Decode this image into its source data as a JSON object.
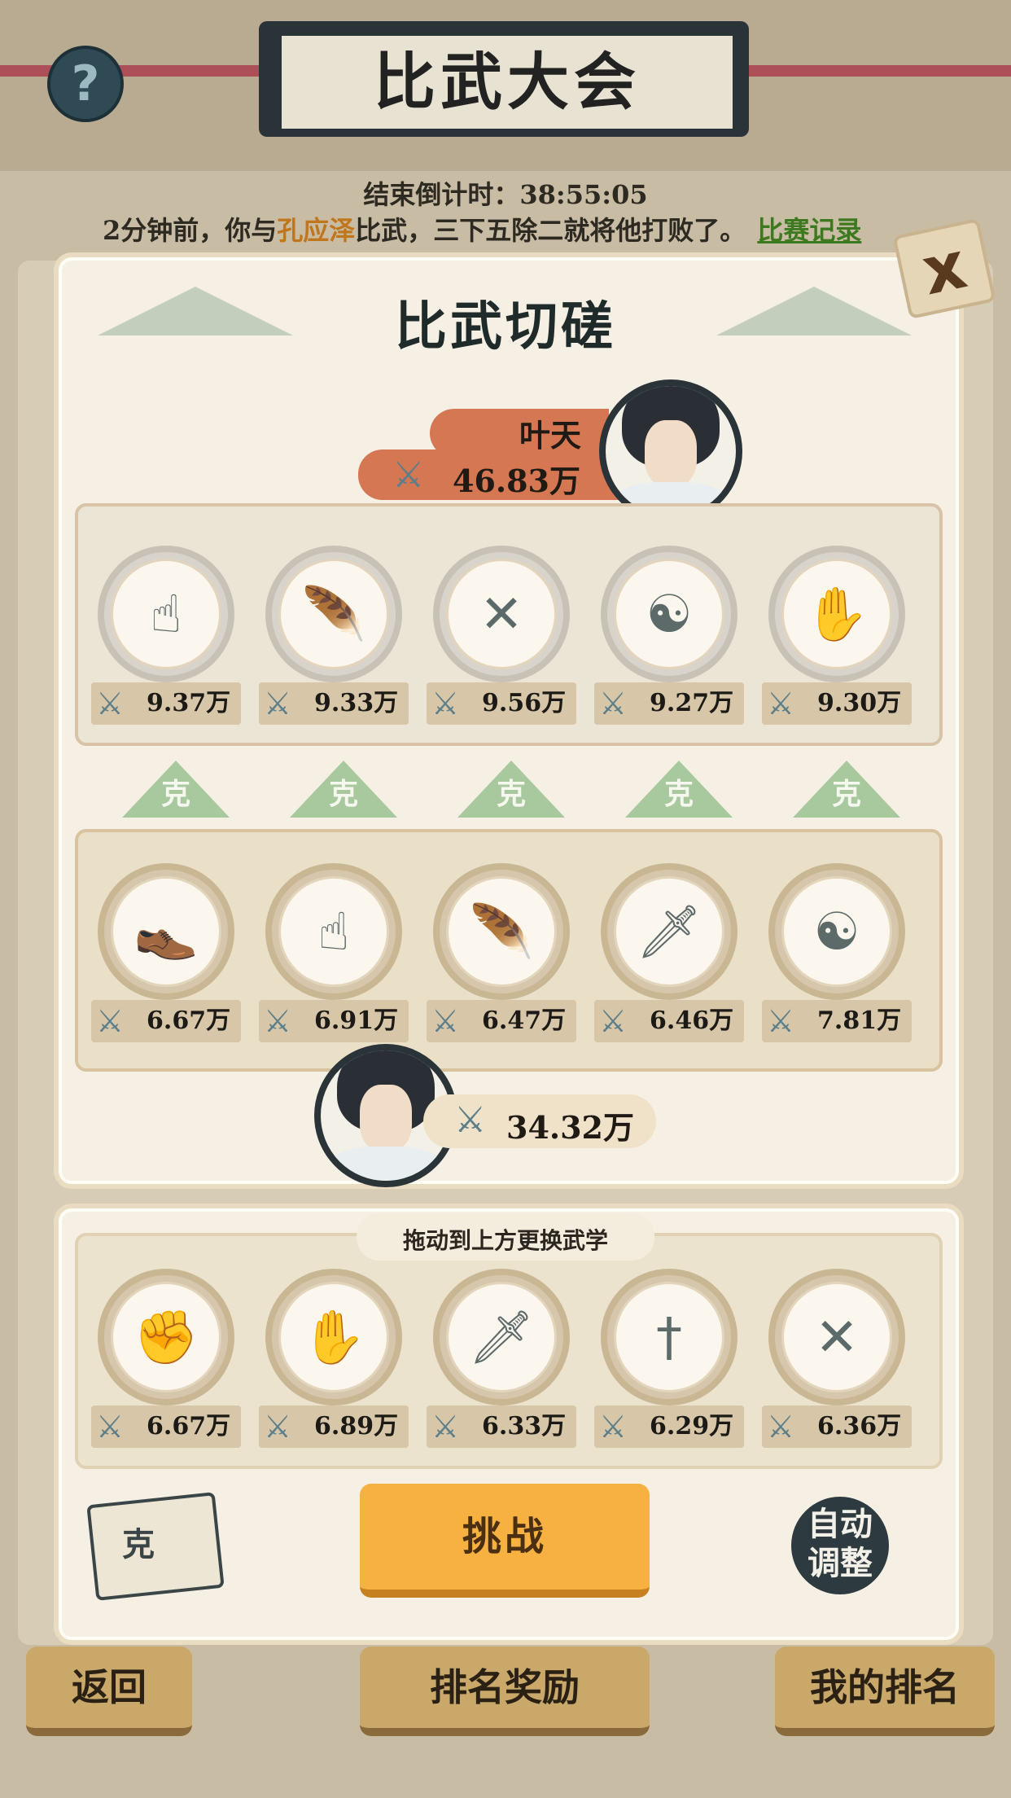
{
  "header": {
    "title": "比武大会",
    "help_icon": "?",
    "countdown": "结束倒计时：38:55:05",
    "log_prefix": "2分钟前，你与",
    "log_name": "孔应泽",
    "log_suffix": "比武，三下五除二就将他打败了。",
    "log_link": "比赛记录"
  },
  "dialog": {
    "title": "比武切磋",
    "close_icon": "x"
  },
  "opponent": {
    "name": "叶天",
    "power": "46.83万",
    "skills": [
      {
        "icon": "finger-gesture-icon",
        "glyph": "☝",
        "power": "9.37万"
      },
      {
        "icon": "feather-icon",
        "glyph": "🪶",
        "power": "9.33万"
      },
      {
        "icon": "crossed-spears-icon",
        "glyph": "✕",
        "power": "9.56万"
      },
      {
        "icon": "meditation-icon",
        "glyph": "☯",
        "power": "9.27万"
      },
      {
        "icon": "open-palm-icon",
        "glyph": "✋",
        "power": "9.30万"
      }
    ]
  },
  "counter_label": "克",
  "player": {
    "power": "34.32万",
    "skills": [
      {
        "icon": "boot-icon",
        "glyph": "👞",
        "power": "6.67万"
      },
      {
        "icon": "finger-gesture-icon",
        "glyph": "☝",
        "power": "6.91万"
      },
      {
        "icon": "feather-icon",
        "glyph": "🪶",
        "power": "6.47万"
      },
      {
        "icon": "throwing-daggers-icon",
        "glyph": "🗡",
        "power": "6.46万"
      },
      {
        "icon": "meditation-icon",
        "glyph": "☯",
        "power": "7.81万"
      }
    ]
  },
  "pool": {
    "hint": "拖动到上方更换武学",
    "skills": [
      {
        "icon": "fist-icon",
        "glyph": "✊",
        "power": "6.67万"
      },
      {
        "icon": "open-palm-icon",
        "glyph": "✋",
        "power": "6.89万"
      },
      {
        "icon": "saber-icon",
        "glyph": "🗡",
        "power": "6.33万"
      },
      {
        "icon": "sword-icon",
        "glyph": "†",
        "power": "6.29万"
      },
      {
        "icon": "crossed-spears-icon",
        "glyph": "✕",
        "power": "6.36万"
      }
    ]
  },
  "actions": {
    "book_label": "克",
    "challenge": "挑战",
    "auto_adjust": "自动\n调整"
  },
  "bottom_nav": {
    "back": "返回",
    "rank_reward": "排名奖励",
    "my_rank": "我的排名"
  },
  "colors": {
    "accent_orange": "#f6b140",
    "opponent_pill": "#d67753",
    "counter_green": "#a8c89e"
  }
}
